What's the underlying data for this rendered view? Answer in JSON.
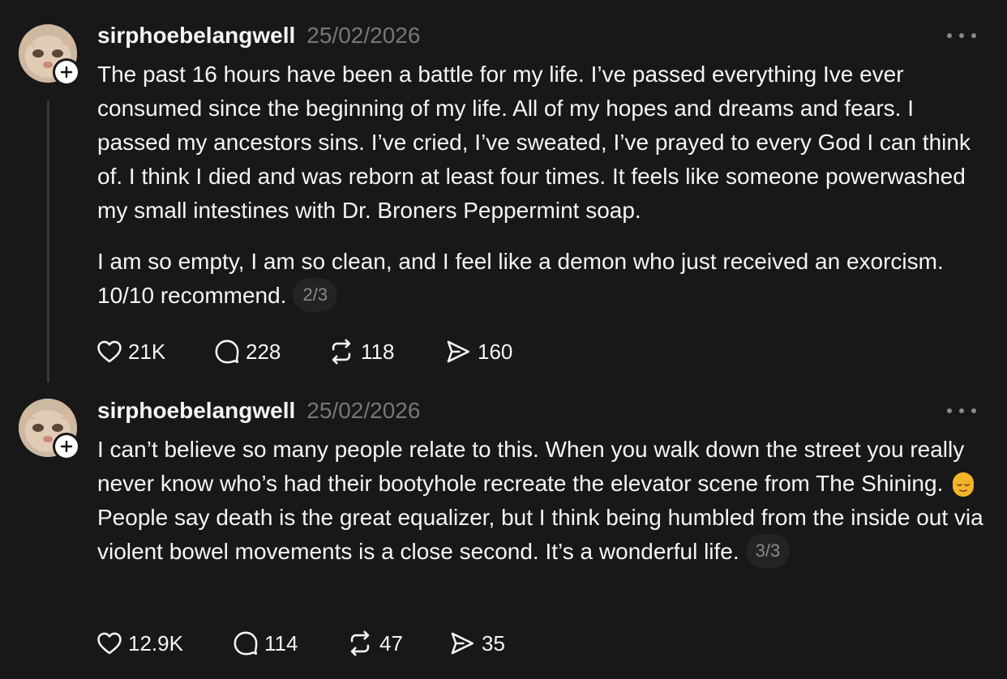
{
  "posts": [
    {
      "username": "sirphoebelangwell",
      "timestamp": "25/02/2026",
      "paragraphs": [
        "The past 16 hours have been a battle for my life. I’ve passed everything Ive ever consumed since the beginning of my life. All of my hopes and dreams and fears. I passed my ancestors sins. I’ve cried, I’ve sweated, I’ve prayed to every God I can think of. I think I died and was reborn at least four times. It feels like someone powerwashed my small intestines with Dr. Broners Peppermint soap.",
        "I am so empty, I am so clean, and I feel like a demon who just received an exorcism. 10/10 recommend."
      ],
      "counter": "2/3",
      "likes": "21K",
      "replies": "228",
      "reposts": "118",
      "shares": "160"
    },
    {
      "username": "sirphoebelangwell",
      "timestamp": "25/02/2026",
      "text_before_emoji": "I can’t believe so many people relate to this. When you walk down the street you really never know who’s had their bootyhole recreate the elevator scene from The Shining.",
      "emoji": "relieved-face-emoji",
      "text_after_emoji": "People say death is the great equalizer, but I think being humbled from the inside out via violent bowel movements is a close second. It’s a wonderful life.",
      "counter": "3/3",
      "likes": "12.9K",
      "replies": "114",
      "reposts": "47",
      "shares": "35"
    }
  ],
  "icons": {
    "like": "heart-icon",
    "reply": "comment-bubble-icon",
    "repost": "repost-arrows-icon",
    "share": "share-paper-plane-icon",
    "more": "more-options-icon",
    "follow": "plus-icon"
  },
  "colors": {
    "background": "#181818",
    "text": "#f3f5f7",
    "muted": "#777777",
    "thread_line": "#3a3a3a"
  }
}
